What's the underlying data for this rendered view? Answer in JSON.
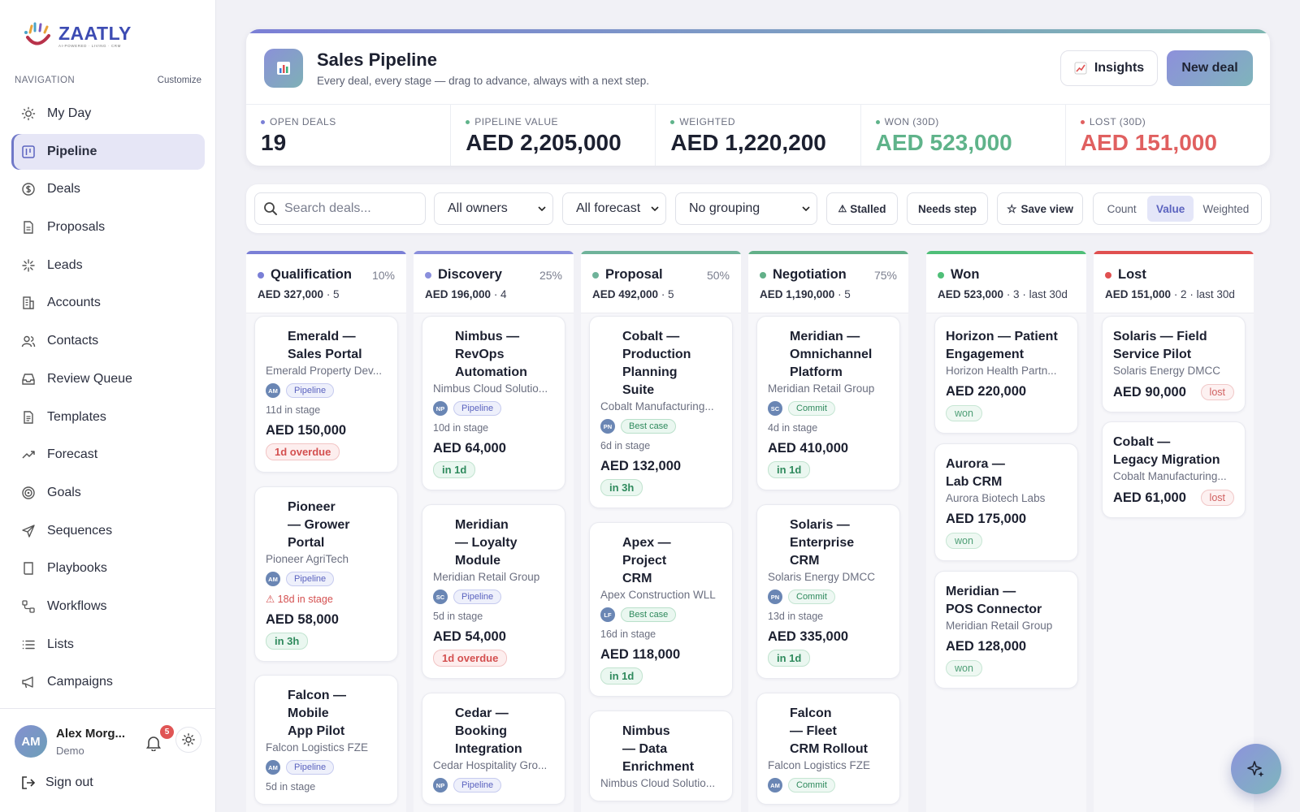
{
  "brand": {
    "name": "ZAATLY",
    "tagline": "AI-POWERED · LIVING · CRM"
  },
  "sidebar": {
    "heading": "NAVIGATION",
    "customize": "Customize",
    "items": [
      {
        "label": "My Day",
        "icon": "sun-icon"
      },
      {
        "label": "Pipeline",
        "icon": "kanban-icon",
        "active": true
      },
      {
        "label": "Deals",
        "icon": "dollar-circle-icon"
      },
      {
        "label": "Proposals",
        "icon": "document-icon"
      },
      {
        "label": "Leads",
        "icon": "sparkle-icon"
      },
      {
        "label": "Accounts",
        "icon": "building-icon"
      },
      {
        "label": "Contacts",
        "icon": "users-icon"
      },
      {
        "label": "Review Queue",
        "icon": "inbox-icon"
      },
      {
        "label": "Templates",
        "icon": "file-text-icon"
      },
      {
        "label": "Forecast",
        "icon": "trend-up-icon"
      },
      {
        "label": "Goals",
        "icon": "target-icon"
      },
      {
        "label": "Sequences",
        "icon": "send-icon"
      },
      {
        "label": "Playbooks",
        "icon": "book-icon"
      },
      {
        "label": "Workflows",
        "icon": "workflow-icon"
      },
      {
        "label": "Lists",
        "icon": "list-icon"
      },
      {
        "label": "Campaigns",
        "icon": "megaphone-icon"
      }
    ],
    "user": {
      "initials": "AM",
      "name": "Alex Morg...",
      "role": "Demo",
      "notifications": "5"
    },
    "signout": "Sign out"
  },
  "header": {
    "title": "Sales Pipeline",
    "subtitle": "Every deal, every stage — drag to advance, always with a next step.",
    "insights_label": "Insights",
    "new_deal_label": "New deal",
    "kpis": [
      {
        "label": "OPEN DEALS",
        "value": "19",
        "color": "#7a7fd6"
      },
      {
        "label": "PIPELINE VALUE",
        "value": "AED 2,205,000",
        "color": "#5fb38a"
      },
      {
        "label": "WEIGHTED",
        "value": "AED 1,220,200",
        "color": "#5fb38a"
      },
      {
        "label": "WON (30D)",
        "value": "AED 523,000",
        "color": "#5fb38a"
      },
      {
        "label": "LOST (30D)",
        "value": "AED 151,000",
        "color": "#e06060"
      }
    ]
  },
  "toolbar": {
    "search_placeholder": "Search deals...",
    "owners": "All owners",
    "forecast": "All forecast",
    "grouping": "No grouping",
    "stalled": "Stalled",
    "needs_step": "Needs step",
    "save_view": "Save view",
    "modes": [
      "Count",
      "Value",
      "Weighted"
    ],
    "active_mode": "Value"
  },
  "columns": [
    {
      "name": "Qualification",
      "pct": "10%",
      "amount": "AED 327,000",
      "meta": " · 5",
      "color": "#7a7fd6",
      "cards": [
        {
          "title": [
            "Emerald —",
            "Sales Portal"
          ],
          "account": "Emerald Property Dev...",
          "owner": "AM",
          "tag": "Pipeline",
          "stage": "11d in stage",
          "amount": "AED 150,000",
          "due": "1d overdue",
          "due_type": "bad"
        },
        {
          "title": [
            "Pioneer",
            "— Grower",
            "Portal"
          ],
          "account": "Pioneer AgriTech",
          "owner": "AM",
          "tag": "Pipeline",
          "stage": "⚠ 18d in stage",
          "stage_warn": true,
          "amount": "AED 58,000",
          "due": "in 3h",
          "due_type": "ok"
        },
        {
          "title": [
            "Falcon —",
            "Mobile",
            "App Pilot"
          ],
          "account": "Falcon Logistics FZE",
          "owner": "AM",
          "tag": "Pipeline",
          "stage": "5d in stage"
        }
      ]
    },
    {
      "name": "Discovery",
      "pct": "25%",
      "amount": "AED 196,000",
      "meta": " · 4",
      "color": "#8a8fdc",
      "cards": [
        {
          "title": [
            "Nimbus —",
            "RevOps",
            "Automation"
          ],
          "account": "Nimbus Cloud Solutio...",
          "owner": "NP",
          "tag": "Pipeline",
          "stage": "10d in stage",
          "amount": "AED 64,000",
          "due": "in 1d",
          "due_type": "ok"
        },
        {
          "title": [
            "Meridian",
            "— Loyalty",
            "Module"
          ],
          "account": "Meridian Retail Group",
          "owner": "SC",
          "tag": "Pipeline",
          "stage": "5d in stage",
          "amount": "AED 54,000",
          "due": "1d overdue",
          "due_type": "bad"
        },
        {
          "title": [
            "Cedar —",
            "Booking",
            "Integration"
          ],
          "account": "Cedar Hospitality Gro...",
          "owner": "NP",
          "tag": "Pipeline"
        }
      ]
    },
    {
      "name": "Proposal",
      "pct": "50%",
      "amount": "AED 492,000",
      "meta": " · 5",
      "color": "#6fb39a",
      "cards": [
        {
          "title": [
            "Cobalt —",
            "Production",
            "Planning",
            "Suite"
          ],
          "account": "Cobalt Manufacturing...",
          "owner": "PN",
          "tag": "Best case",
          "stage": "6d in stage",
          "amount": "AED 132,000",
          "due": "in 3h",
          "due_type": "ok"
        },
        {
          "title": [
            "Apex —",
            "Project",
            "CRM"
          ],
          "account": "Apex Construction WLL",
          "owner": "LF",
          "tag": "Best case",
          "stage": "16d in stage",
          "amount": "AED 118,000",
          "due": "in 1d",
          "due_type": "ok"
        },
        {
          "title": [
            "Nimbus",
            "— Data",
            "Enrichment"
          ],
          "account": "Nimbus Cloud Solutio..."
        }
      ]
    },
    {
      "name": "Negotiation",
      "pct": "75%",
      "amount": "AED 1,190,000",
      "meta": " · 5",
      "color": "#62b088",
      "cards": [
        {
          "title": [
            "Meridian —",
            "Omnichannel",
            "Platform"
          ],
          "account": "Meridian Retail Group",
          "owner": "SC",
          "tag": "Commit",
          "stage": "4d in stage",
          "amount": "AED 410,000",
          "due": "in 1d",
          "due_type": "ok"
        },
        {
          "title": [
            "Solaris —",
            "Enterprise",
            "CRM"
          ],
          "account": "Solaris Energy DMCC",
          "owner": "PN",
          "tag": "Commit",
          "stage": "13d in stage",
          "amount": "AED 335,000",
          "due": "in 1d",
          "due_type": "ok"
        },
        {
          "title": [
            "Falcon",
            "— Fleet",
            "CRM Rollout"
          ],
          "account": "Falcon Logistics FZE",
          "owner": "AM",
          "tag": "Commit"
        }
      ]
    },
    {
      "name": "Won",
      "pct": "",
      "amount": "AED 523,000",
      "meta": " · 3 · last 30d",
      "color": "#4fbf78",
      "cards": [
        {
          "title": [
            "Horizon — Patient",
            "Engagement"
          ],
          "account": "Horizon Health Partn...",
          "amount": "AED 220,000",
          "pill": "won"
        },
        {
          "title": [
            "Aurora —",
            "Lab CRM"
          ],
          "account": "Aurora Biotech Labs",
          "amount": "AED 175,000",
          "pill": "won"
        },
        {
          "title": [
            "Meridian —",
            "POS Connector"
          ],
          "account": "Meridian Retail Group",
          "amount": "AED 128,000",
          "pill": "won"
        }
      ]
    },
    {
      "name": "Lost",
      "pct": "",
      "amount": "AED 151,000",
      "meta": " · 2 · last 30d",
      "color": "#e05050",
      "cards": [
        {
          "title": [
            "Solaris — Field",
            "Service Pilot"
          ],
          "account": "Solaris Energy DMCC",
          "amount": "AED 90,000",
          "pill": "lost"
        },
        {
          "title": [
            "Cobalt —",
            "Legacy Migration"
          ],
          "account": "Cobalt Manufacturing...",
          "amount": "AED 61,000",
          "pill": "lost"
        }
      ]
    }
  ]
}
